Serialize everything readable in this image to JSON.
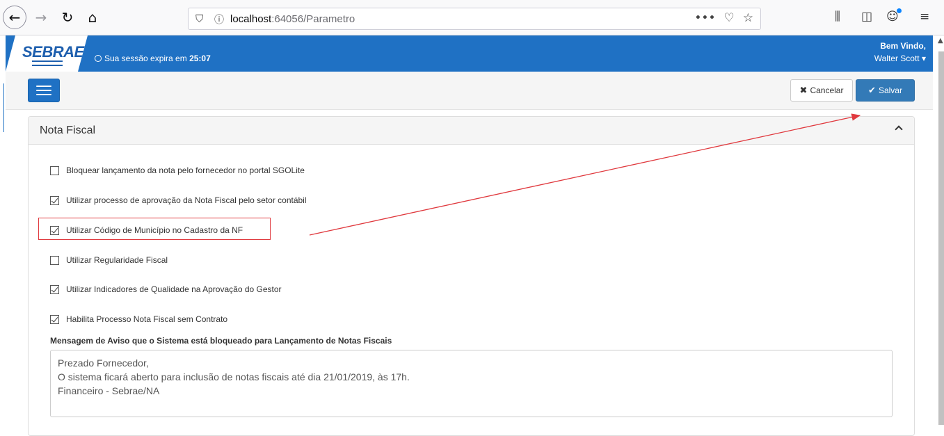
{
  "browser": {
    "url_host": "localhost",
    "url_rest": ":64056/Parametro",
    "page_actions": "•••"
  },
  "header": {
    "logo": "SEBRAE",
    "session_prefix": "Sua sessão expira em",
    "session_time": "25:07",
    "welcome_line1": "Bem Vindo,",
    "welcome_user": "Walter Scott ▾"
  },
  "toolbar": {
    "cancel_label": "Cancelar",
    "save_label": "Salvar"
  },
  "panel": {
    "title": "Nota Fiscal",
    "options": [
      {
        "label": "Bloquear lançamento da nota pelo fornecedor no portal SGOLite",
        "checked": false
      },
      {
        "label": "Utilizar processo de aprovação da Nota Fiscal pelo setor contábil",
        "checked": true
      },
      {
        "label": "Utilizar Código de Município no Cadastro da NF",
        "checked": true
      },
      {
        "label": "Utilizar Regularidade Fiscal",
        "checked": false
      },
      {
        "label": "Utilizar Indicadores de Qualidade na Aprovação do Gestor",
        "checked": true
      },
      {
        "label": "Habilita Processo Nota Fiscal sem Contrato",
        "checked": true
      }
    ],
    "message_label": "Mensagem de Aviso que o Sistema está bloqueado para Lançamento de Notas Fiscais",
    "message_lines": [
      "Prezado Fornecedor,",
      "O sistema ficará aberto para inclusão de notas fiscais até dia 21/01/2019, às 17h.",
      "Financeiro - Sebrae/NA"
    ]
  },
  "colors": {
    "brand_blue": "#1f71c4",
    "save_blue": "#337ab7",
    "annotation_red": "#e0393e"
  }
}
